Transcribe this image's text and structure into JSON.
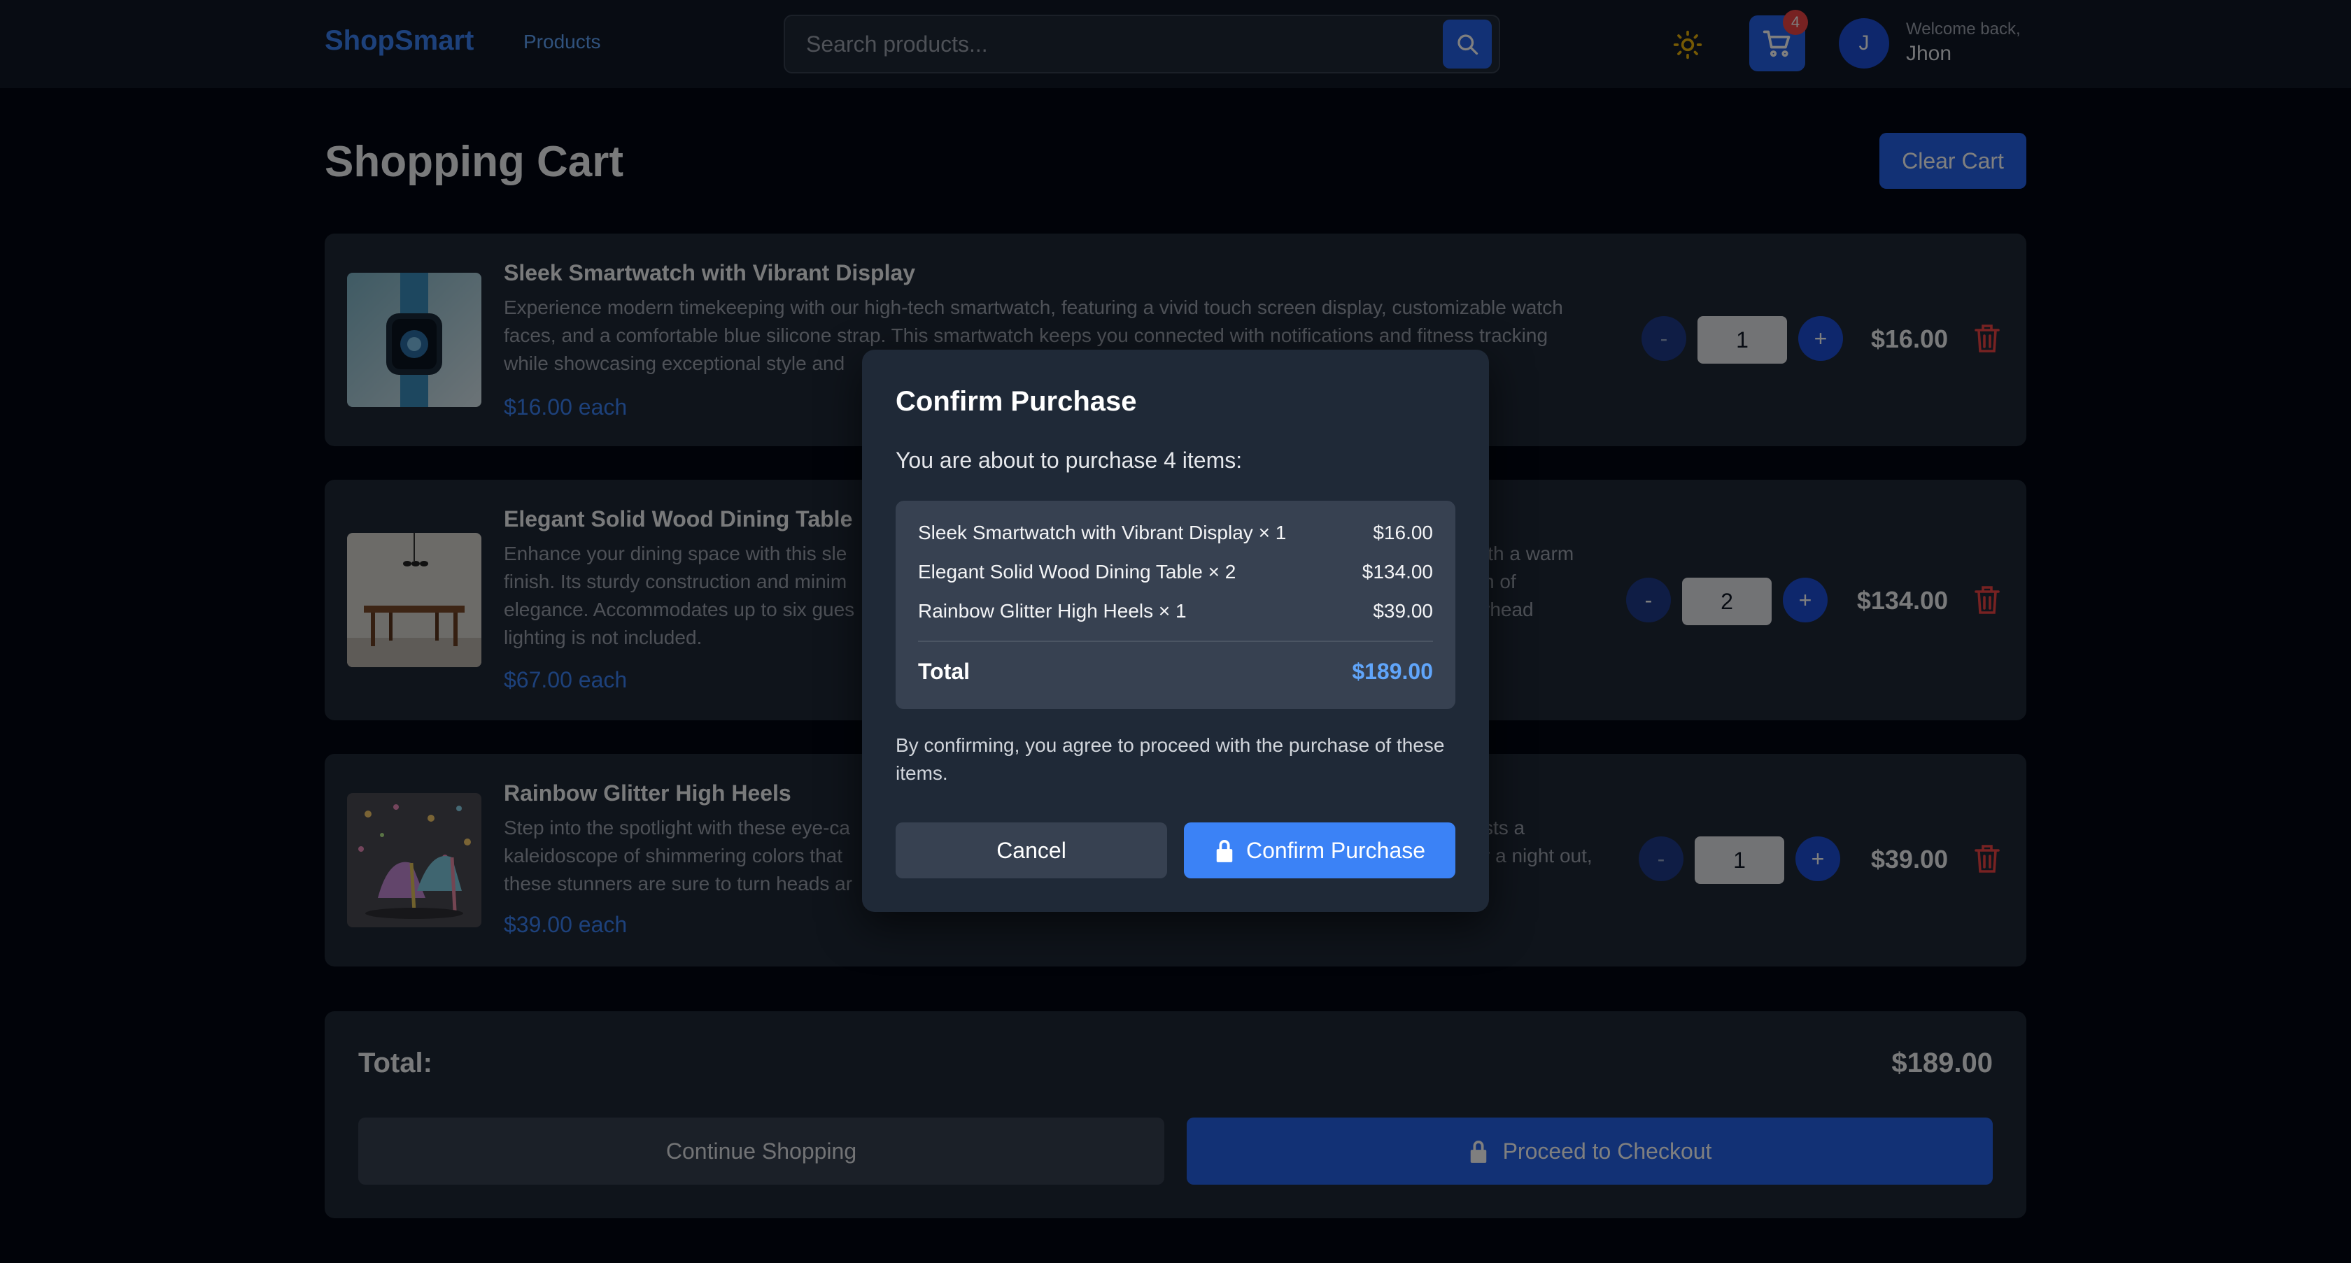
{
  "header": {
    "logo": "ShopSmart",
    "nav_products": "Products",
    "search_placeholder": "Search products...",
    "cart_count": "4",
    "avatar_initial": "J",
    "welcome": "Welcome back,",
    "username": "Jhon"
  },
  "page": {
    "title": "Shopping Cart",
    "clear_cart": "Clear Cart"
  },
  "items": [
    {
      "title": "Sleek Smartwatch with Vibrant Display",
      "desc_lines": [
        "Experience modern timekeeping with our high-tech smartwatch, featuring a vivid touch screen display, customizable watch",
        "faces, and a comfortable blue silicone strap. This smartwatch keeps you connected with notifications and fitness tracking",
        "while showcasing exceptional style and"
      ],
      "each": "$16.00 each",
      "qty": "1",
      "total": "$16.00"
    },
    {
      "title": "Elegant Solid Wood Dining Table",
      "desc_lines": [
        "Enhance your dining space with this sle",
        "finish. Its sturdy construction and minim",
        "elegance. Accommodates up to six gues",
        "lighting is not included."
      ],
      "desc_right_lines": [
        "ith a warm",
        "h of",
        "rhead"
      ],
      "each": "$67.00 each",
      "qty": "2",
      "total": "$134.00"
    },
    {
      "title": "Rainbow Glitter High Heels",
      "desc_lines": [
        "Step into the spotlight with these eye-ca",
        "kaleidoscope of shimmering colors that",
        "these stunners are sure to turn heads ar"
      ],
      "desc_right_lines": [
        "sts a",
        "r a night out,"
      ],
      "each": "$39.00 each",
      "qty": "1",
      "total": "$39.00"
    }
  ],
  "qty_controls": {
    "minus": "-",
    "plus": "+"
  },
  "summary": {
    "label": "Total:",
    "value": "$189.00",
    "continue": "Continue Shopping",
    "checkout": "Proceed to Checkout"
  },
  "modal": {
    "title": "Confirm Purchase",
    "subtitle": "You are about to purchase 4 items:",
    "lines": [
      {
        "name": "Sleek Smartwatch with Vibrant Display × 1",
        "price": "$16.00"
      },
      {
        "name": "Elegant Solid Wood Dining Table × 2",
        "price": "$134.00"
      },
      {
        "name": "Rainbow Glitter High Heels × 1",
        "price": "$39.00"
      }
    ],
    "total_label": "Total",
    "total_value": "$189.00",
    "note": "By confirming, you agree to proceed with the purchase of these items.",
    "cancel": "Cancel",
    "confirm": "Confirm Purchase"
  },
  "colors": {
    "background": "#030712",
    "surface": "#1f2937",
    "accent": "#2563eb",
    "danger": "#ef4444",
    "price": "#3b82f6"
  }
}
